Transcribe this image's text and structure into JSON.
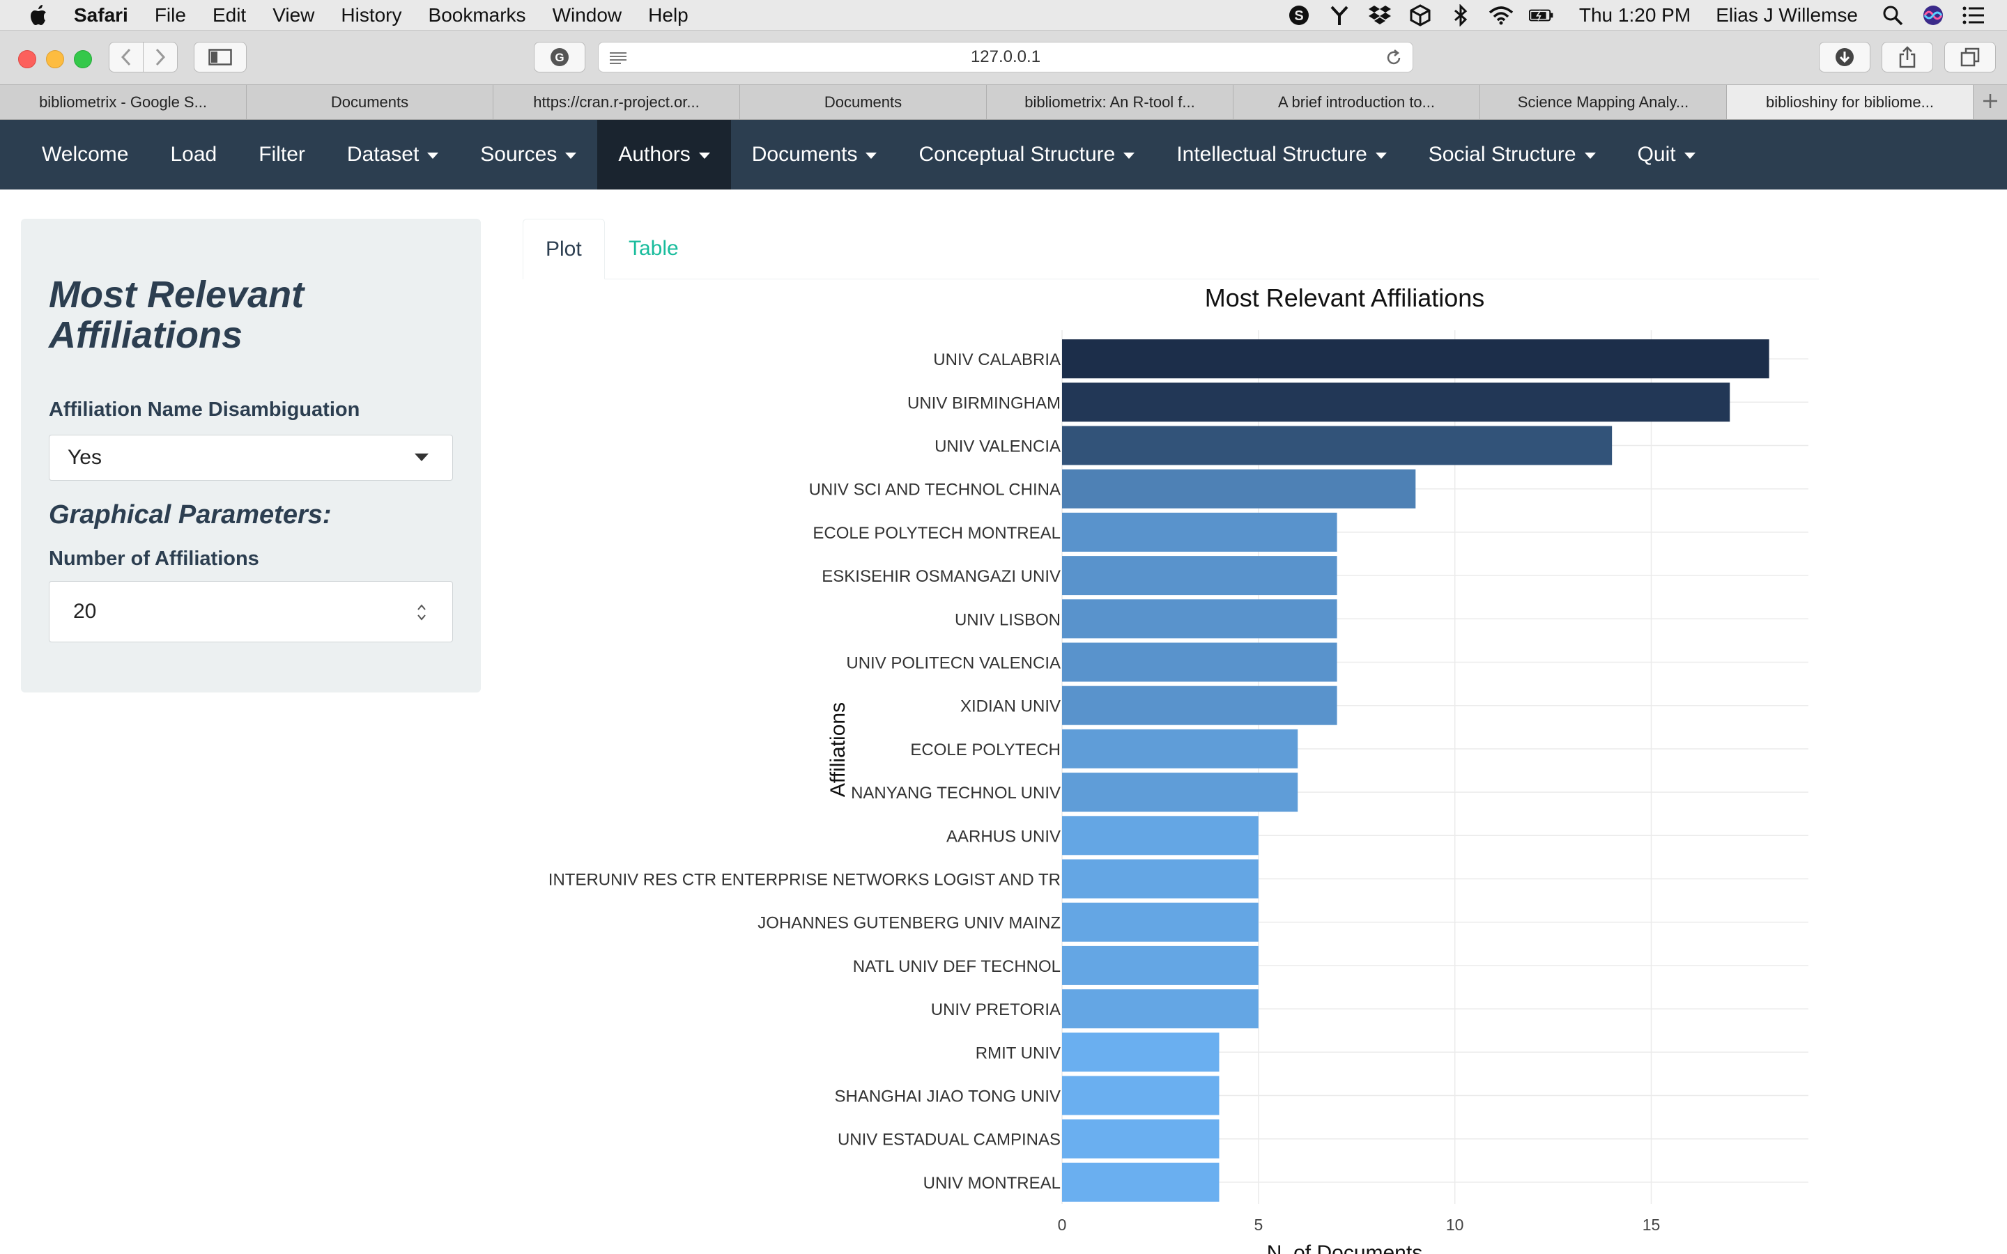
{
  "menubar": {
    "app": "Safari",
    "items": [
      "File",
      "Edit",
      "View",
      "History",
      "Bookmarks",
      "Window",
      "Help"
    ],
    "status_icons": [
      "skype-icon",
      "fork-icon",
      "dropbox-icon",
      "box-icon",
      "bluetooth-icon",
      "wifi-icon",
      "battery-icon"
    ],
    "clock": "Thu 1:20 PM",
    "user": "Elias J Willemse"
  },
  "browser": {
    "url": "127.0.0.1",
    "tabs": [
      {
        "label": "bibliometrix - Google S...",
        "active": false
      },
      {
        "label": "Documents",
        "active": false
      },
      {
        "label": "https://cran.r-project.or...",
        "active": false
      },
      {
        "label": "Documents",
        "active": false
      },
      {
        "label": "bibliometrix: An R-tool f...",
        "active": false
      },
      {
        "label": "A brief introduction to...",
        "active": false
      },
      {
        "label": "Science Mapping Analy...",
        "active": false
      },
      {
        "label": "biblioshiny for bibliome...",
        "active": true
      }
    ]
  },
  "navbar": {
    "items": [
      {
        "label": "Welcome",
        "dropdown": false,
        "active": false
      },
      {
        "label": "Load",
        "dropdown": false,
        "active": false
      },
      {
        "label": "Filter",
        "dropdown": false,
        "active": false
      },
      {
        "label": "Dataset",
        "dropdown": true,
        "active": false
      },
      {
        "label": "Sources",
        "dropdown": true,
        "active": false
      },
      {
        "label": "Authors",
        "dropdown": true,
        "active": true
      },
      {
        "label": "Documents",
        "dropdown": true,
        "active": false
      },
      {
        "label": "Conceptual Structure",
        "dropdown": true,
        "active": false
      },
      {
        "label": "Intellectual Structure",
        "dropdown": true,
        "active": false
      },
      {
        "label": "Social Structure",
        "dropdown": true,
        "active": false
      },
      {
        "label": "Quit",
        "dropdown": true,
        "active": false
      }
    ]
  },
  "sidebar": {
    "title": "Most Relevant Affiliations",
    "disambiguation_label": "Affiliation Name Disambiguation",
    "disambiguation_value": "Yes",
    "graph_params_label": "Graphical Parameters:",
    "num_label": "Number of Affiliations",
    "num_value": "20"
  },
  "output_tabs": [
    "Plot",
    "Table"
  ],
  "colors": {
    "navbar": "#2c3e50",
    "navbar_active": "#1a242f",
    "accent": "#18bc9c",
    "bar_dark": "#1c2e4a",
    "bar_light": "#6aaff0"
  },
  "chart_data": {
    "type": "bar",
    "orientation": "horizontal",
    "title": "Most Relevant Affiliations",
    "xlabel": "N. of Documents",
    "ylabel": "Affiliations",
    "xlim": [
      0,
      19
    ],
    "xticks": [
      0,
      5,
      10,
      15
    ],
    "grid": true,
    "categories": [
      "UNIV CALABRIA",
      "UNIV BIRMINGHAM",
      "UNIV VALENCIA",
      "UNIV SCI AND TECHNOL CHINA",
      "ECOLE POLYTECH MONTREAL",
      "ESKISEHIR OSMANGAZI UNIV",
      "UNIV LISBON",
      "UNIV POLITECN VALENCIA",
      "XIDIAN UNIV",
      "ECOLE POLYTECH",
      "NANYANG TECHNOL UNIV",
      "AARHUS UNIV",
      "INTERUNIV RES CTR ENTERPRISE NETWORKS LOGIST AND TR",
      "JOHANNES GUTENBERG UNIV MAINZ",
      "NATL UNIV DEF TECHNOL",
      "UNIV PRETORIA",
      "RMIT UNIV",
      "SHANGHAI JIAO TONG UNIV",
      "UNIV ESTADUAL CAMPINAS",
      "UNIV MONTREAL"
    ],
    "values": [
      18,
      17,
      14,
      9,
      7,
      7,
      7,
      7,
      7,
      6,
      6,
      5,
      5,
      5,
      5,
      5,
      4,
      4,
      4,
      4
    ]
  }
}
